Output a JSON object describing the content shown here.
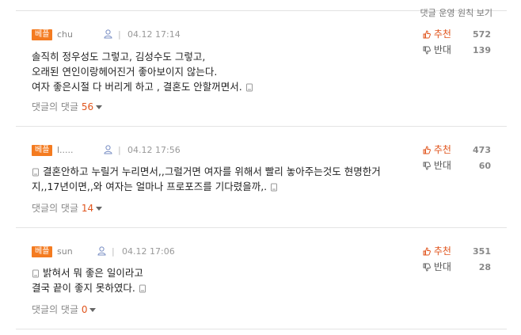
{
  "header": {
    "sort_link": "댓글 운영 원칙 보기"
  },
  "comments": [
    {
      "badge": "베플",
      "username": "chun",
      "separator": "|",
      "time": "04.12 17:14",
      "upvote_label": "추천",
      "upvote_count": "572",
      "downvote_label": "반대",
      "downvote_count": "139",
      "lines": [
        "솔직히 정우성도 그렇고, 김성수도 그렇고,",
        "오래된 연인이랑헤어진거 좋아보이지 않는다.",
        "여자 좋은시절 다 버리게 하고 , 결혼도 안할꺼면서."
      ],
      "reply_label": "댓글의 댓글",
      "reply_count": "56"
    },
    {
      "badge": "베플",
      "username": "l.....",
      "separator": "|",
      "time": "04.12 17:56",
      "upvote_label": "추천",
      "upvote_count": "473",
      "downvote_label": "반대",
      "downvote_count": "60",
      "lines": [
        "결혼안하고 누릴거 누리면서,,그럴거면 여자를 위해서 빨리 놓아주는것도 현명한거",
        "지,,17년이면,,와 여자는 얼마나 프로포즈를 기다렸을까,."
      ],
      "reply_label": "댓글의 댓글",
      "reply_count": "14"
    },
    {
      "badge": "베플",
      "username": "sun",
      "separator": "|",
      "time": "04.12 17:06",
      "upvote_label": "추천",
      "upvote_count": "351",
      "downvote_label": "반대",
      "downvote_count": "28",
      "lines": [
        "밝혀서 뭐 좋은 일이라고",
        "결국 끝이 좋지 못하였다."
      ],
      "reply_label": "댓글의 댓글",
      "reply_count": "0"
    }
  ],
  "colors": {
    "accent": "#f47b20",
    "upvote": "#e0541c"
  },
  "icons": {
    "user": "user-icon",
    "mobile": "mobile-icon",
    "thumb_up": "thumb-up-icon",
    "thumb_down": "thumb-down-icon",
    "caret": "caret-down-icon"
  }
}
